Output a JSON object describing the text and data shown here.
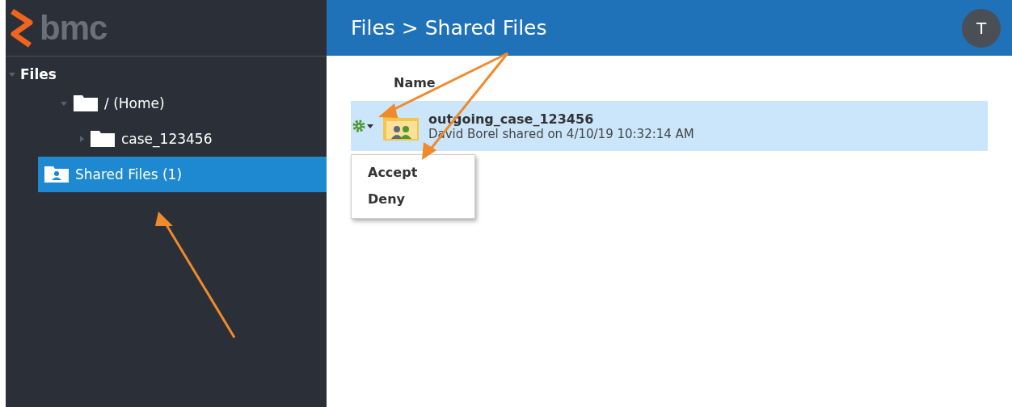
{
  "logo": {
    "text": "bmc"
  },
  "sidebar": {
    "section": {
      "label": "Files",
      "expanded": true
    },
    "items": [
      {
        "label": "/ (Home)",
        "kind": "folder",
        "expanded": true,
        "selected": false,
        "children": [
          {
            "label": "case_123456",
            "kind": "folder",
            "expanded": false,
            "selected": false
          }
        ]
      },
      {
        "label": "Shared Files (1)",
        "kind": "shared",
        "selected": true
      }
    ]
  },
  "header": {
    "breadcrumb": "Files > Shared Files",
    "avatar": "T"
  },
  "table": {
    "columns": [
      "Name"
    ],
    "rows": [
      {
        "name": "outgoing_case_123456",
        "detail": "David Borel shared on 4/10/19 10:32:14 AM",
        "selected": true
      }
    ]
  },
  "menu": {
    "open": true,
    "items": [
      "Accept",
      "Deny"
    ]
  },
  "annotations": [
    {
      "kind": "arrow"
    },
    {
      "kind": "arrow"
    },
    {
      "kind": "arrow"
    }
  ]
}
